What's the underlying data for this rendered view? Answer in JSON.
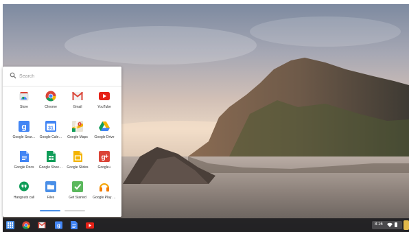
{
  "search": {
    "placeholder": "Search",
    "icon": "search-icon"
  },
  "apps": [
    {
      "label": "Store",
      "icon": "web-store-icon"
    },
    {
      "label": "Chrome",
      "icon": "chrome-icon"
    },
    {
      "label": "Gmail",
      "icon": "gmail-icon"
    },
    {
      "label": "YouTube",
      "icon": "youtube-icon"
    },
    {
      "label": "Google Sear…",
      "icon": "google-search-icon"
    },
    {
      "label": "Google Cale…",
      "icon": "google-calendar-icon"
    },
    {
      "label": "Google Maps",
      "icon": "google-maps-icon"
    },
    {
      "label": "Google Drive",
      "icon": "google-drive-icon"
    },
    {
      "label": "Google Docs",
      "icon": "google-docs-icon"
    },
    {
      "label": "Google Shee…",
      "icon": "google-sheets-icon"
    },
    {
      "label": "Google Slides",
      "icon": "google-slides-icon"
    },
    {
      "label": "Google+",
      "icon": "google-plus-icon"
    },
    {
      "label": "Hangouts call",
      "icon": "hangouts-icon"
    },
    {
      "label": "Files",
      "icon": "files-icon"
    },
    {
      "label": "Get Started",
      "icon": "get-started-icon"
    },
    {
      "label": "Google Play …",
      "icon": "google-play-music-icon"
    }
  ],
  "pagination": {
    "pages": 2,
    "current": 1
  },
  "shelf": {
    "items": [
      {
        "icon": "app-launcher-icon"
      },
      {
        "icon": "chrome-icon"
      },
      {
        "icon": "gmail-icon"
      },
      {
        "icon": "google-search-icon"
      },
      {
        "icon": "google-docs-icon"
      },
      {
        "icon": "youtube-icon"
      }
    ],
    "clock": "8:16",
    "status_icons": [
      "wifi-icon",
      "battery-icon"
    ]
  },
  "colors": {
    "accent": "#4a8fe7",
    "shelf_bg": "#1a1a1e",
    "gmail_red": "#db4437",
    "youtube_red": "#e62117",
    "google_blue": "#4285f4",
    "google_green": "#0f9d58",
    "google_yellow": "#f4b400"
  }
}
